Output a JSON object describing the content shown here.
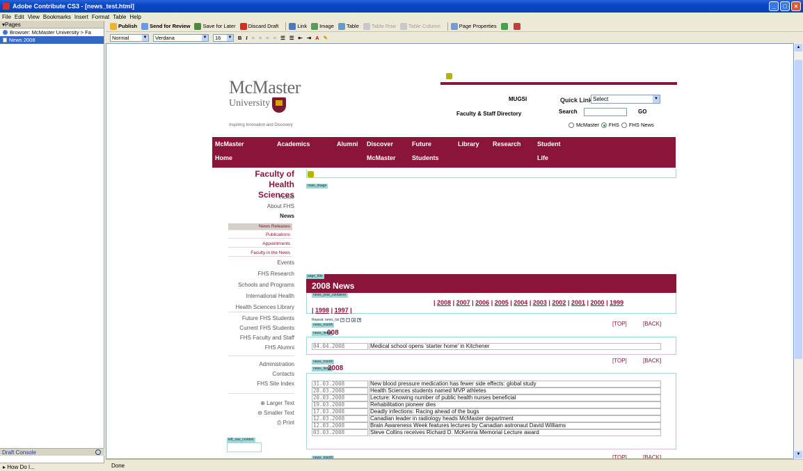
{
  "window": {
    "title": "Adobe Contribute CS3 - [news_test.html]"
  },
  "menu": [
    "File",
    "Edit",
    "View",
    "Bookmarks",
    "Insert",
    "Format",
    "Table",
    "Help"
  ],
  "pages_panel": {
    "header": "Pages",
    "items": [
      "Browser: McMaster University > Fa",
      "News 2008"
    ],
    "draft_console": "Draft Console",
    "how_do_i": "How Do I..."
  },
  "toolbar": {
    "publish": "Publish",
    "send_review": "Send for Review",
    "save_later": "Save for Later",
    "discard": "Discard Draft",
    "link": "Link",
    "image": "Image",
    "table": "Table",
    "table_row": "Table Row",
    "table_column": "Table Column",
    "page_properties": "Page Properties"
  },
  "format_bar": {
    "style": "Normal",
    "font": "Verdana",
    "size": "16",
    "bold": "B",
    "italic": "I",
    "font_color": "A"
  },
  "status": "Done",
  "site": {
    "logo_main": "McMaster",
    "logo_sub": "University",
    "tagline": "Inspiring Innovation and Discovery",
    "mugsi": "MUGSI",
    "quick_links_label": "Quick Links",
    "quick_links_value": "Select",
    "directory": "Faculty & Staff Directory",
    "search_label": "Search",
    "go": "GO",
    "radio_options": [
      "McMaster",
      "FHS",
      "FHS News"
    ],
    "nav": [
      {
        "l1": "McMaster",
        "l2": "Home"
      },
      {
        "l1": "Academics",
        "l2": ""
      },
      {
        "l1": "Alumni",
        "l2": ""
      },
      {
        "l1": "Discover",
        "l2": "McMaster"
      },
      {
        "l1": "Future",
        "l2": "Students"
      },
      {
        "l1": "Library",
        "l2": ""
      },
      {
        "l1": "Research",
        "l2": ""
      },
      {
        "l1": "Student",
        "l2": "Life"
      }
    ],
    "faculty_line1": "Faculty of",
    "faculty_line2": "Health Sciences",
    "sidenav1": [
      "Home",
      "About FHS",
      "News"
    ],
    "sidenav_sub": [
      "News Releases",
      "Publications",
      "Appointments",
      "Faculty in the News"
    ],
    "sidenav2": [
      "Events",
      "FHS Research",
      "Schools and Programs",
      "International Health",
      "Health Sciences Library"
    ],
    "sidenav3": [
      "Future FHS Students",
      "Current FHS Students",
      "FHS Faculty and Staff",
      "FHS Alumni"
    ],
    "sidenav4": [
      "Administration",
      "Contacts",
      "FHS Site Index"
    ],
    "tools": [
      "Larger Text",
      "Smaller Text",
      "Print"
    ]
  },
  "editable_tags": {
    "main_image": "main_image",
    "page_title": "page_title",
    "news_year_container": "news_year_container",
    "repeat": "Repeat: news_list",
    "news_month": "news_month",
    "news_items": "news_items",
    "left_nav_content": "left_nav_content"
  },
  "page_title": "2008 News",
  "years_line1": [
    "2008",
    "2007",
    "2006",
    "2005",
    "2004",
    "2003",
    "2002",
    "2001",
    "2000",
    "1999"
  ],
  "years_line2": [
    "1998",
    "1997"
  ],
  "top": "[TOP]",
  "back": "[BACK]",
  "months": [
    {
      "header": "008",
      "rows": [
        {
          "date": "04.04.2008",
          "headline": "Medical school opens 'starter home' in Kitchener"
        }
      ]
    },
    {
      "header": "2008",
      "rows": [
        {
          "date": "31.03.2008",
          "headline": "New blood pressure medication has fewer side effects: global study"
        },
        {
          "date": "28.03.2008",
          "headline": "Health Sciences students named MVP athletes"
        },
        {
          "date": "20.03.2008",
          "headline": "Lecture: Knowing number of public health nurses beneficial"
        },
        {
          "date": "19.03.2008",
          "headline": "Rehabilitation pioneer dies"
        },
        {
          "date": "17.03.2008",
          "headline": "Deadly infections: Racing ahead of the bugs"
        },
        {
          "date": "12.03.2008",
          "headline": "Canadian leader in radiology heads McMaster department"
        },
        {
          "date": "12.03.2008",
          "headline": "Brain Awareness Week features lectures by Canadian astronaut David Williams"
        },
        {
          "date": "03.03.2008",
          "headline": "Steve Collins receives Richard D. McKenna Memorial Lecture award"
        }
      ]
    }
  ]
}
